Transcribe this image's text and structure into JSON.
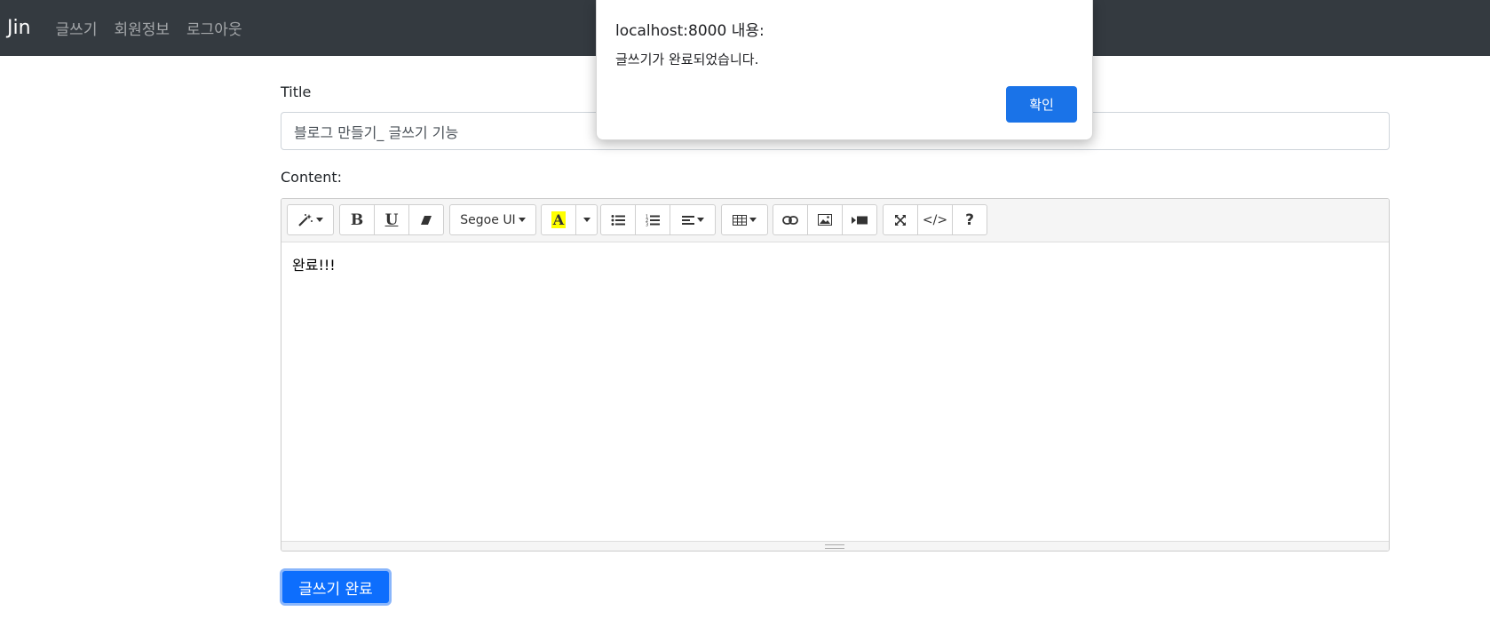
{
  "navbar": {
    "brand": "Jin",
    "links": [
      "글쓰기",
      "회원정보",
      "로그아웃"
    ]
  },
  "form": {
    "title_label": "Title",
    "title_value": "블로그 만들기_ 글쓰기 기능",
    "content_label": "Content:",
    "content_text": "완료!!!",
    "submit_label": "글쓰기 완료"
  },
  "toolbar": {
    "font_name": "Segoe UI",
    "highlight_letter": "A",
    "code_label": "</>",
    "help_label": "?",
    "bold_label": "B",
    "underline_label": "U"
  },
  "dialog": {
    "origin": "localhost:8000 내용:",
    "message": "글쓰기가 완료되었습니다.",
    "ok_label": "확인"
  },
  "colors": {
    "navbar_bg": "#343a40",
    "primary": "#0d6efd",
    "dialog_button": "#1a73e8",
    "highlight": "#ffff00"
  }
}
